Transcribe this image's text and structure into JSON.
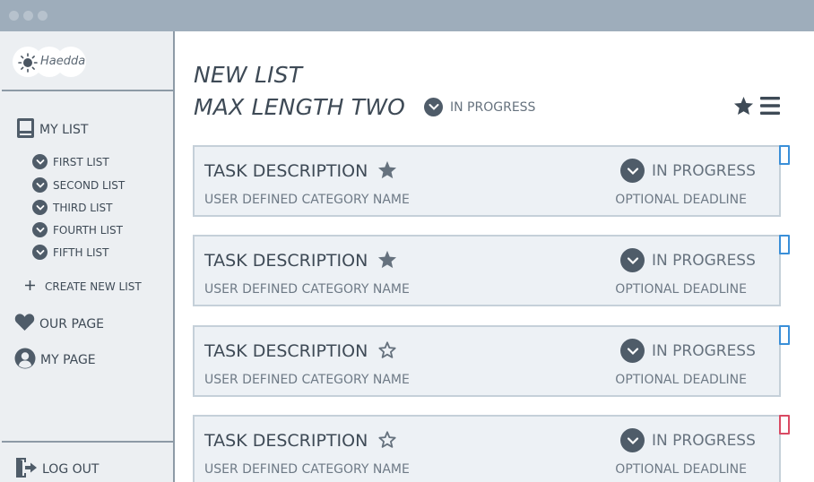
{
  "window": {
    "controls": [
      "close",
      "minimize",
      "maximize"
    ]
  },
  "logo": {
    "text": "Haedda",
    "icon": "sun-icon"
  },
  "sidebar": {
    "my_list": {
      "label": "MY LIST",
      "icon": "book-icon"
    },
    "lists": [
      {
        "label": "FIRST LIST"
      },
      {
        "label": "SECOND LIST"
      },
      {
        "label": "THIRD LIST"
      },
      {
        "label": "FOURTH LIST"
      },
      {
        "label": "FIFTH LIST"
      }
    ],
    "create_new": {
      "label": "CREATE NEW LIST",
      "icon": "plus-icon"
    },
    "our_page": {
      "label": "OUR PAGE",
      "icon": "heart-icon"
    },
    "my_page": {
      "label": "MY PAGE",
      "icon": "user-icon"
    },
    "log_out": {
      "label": "LOG OUT",
      "icon": "logout-icon"
    }
  },
  "header": {
    "title_line1": "NEW LIST",
    "title_line2": "MAX LENGTH TWO",
    "status": "IN PROGRESS",
    "icons": [
      "star-icon",
      "menu-icon"
    ]
  },
  "tasks": [
    {
      "title": "TASK DESCRIPTION",
      "category": "USER DEFINED CATEGORY NAME",
      "status": "IN PROGRESS",
      "deadline": "OPTIONAL DEADLINE",
      "starred": true,
      "flag_color": "#3a8fd8"
    },
    {
      "title": "TASK DESCRIPTION",
      "category": "USER DEFINED CATEGORY NAME",
      "status": "IN PROGRESS",
      "deadline": "OPTIONAL DEADLINE",
      "starred": true,
      "flag_color": "#3a8fd8"
    },
    {
      "title": "TASK DESCRIPTION",
      "category": "USER DEFINED CATEGORY NAME",
      "status": "IN PROGRESS",
      "deadline": "OPTIONAL DEADLINE",
      "starred": false,
      "flag_color": "#3a8fd8"
    },
    {
      "title": "TASK DESCRIPTION",
      "category": "USER DEFINED CATEGORY NAME",
      "status": "IN PROGRESS",
      "deadline": "OPTIONAL DEADLINE",
      "starred": false,
      "flag_color": "#d94a63"
    }
  ],
  "colors": {
    "titlebar": "#9eadbb",
    "sidebar_bg": "#eceff2",
    "card_bg": "#edf1f5",
    "card_border": "#c5d0d9",
    "icon_dark": "#4f5c69",
    "text": "#3e4a56",
    "flag_blue": "#3a8fd8",
    "flag_red": "#d94a63"
  }
}
